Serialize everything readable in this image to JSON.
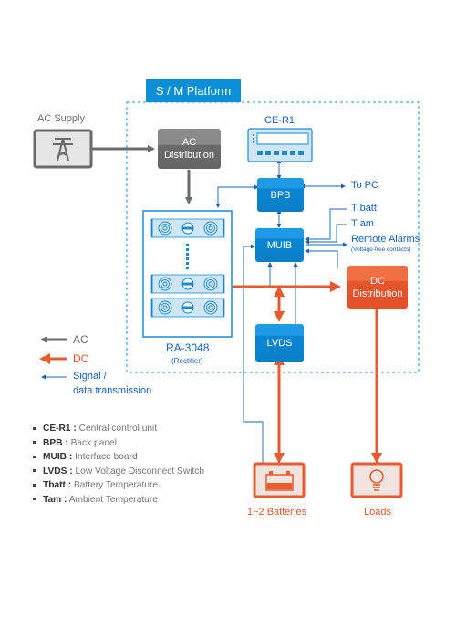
{
  "platform": {
    "title": "S / M Platform"
  },
  "nodes": {
    "ac_supply": {
      "label": "AC Supply",
      "icon": "power-tower-icon"
    },
    "ac_distribution": {
      "line1": "AC",
      "line2": "Distribution"
    },
    "ce_r1": {
      "label": "CE-R1",
      "icon": "control-unit-icon"
    },
    "bpb": {
      "label": "BPB"
    },
    "muib": {
      "label": "MUIB"
    },
    "lvds": {
      "label": "LVDS"
    },
    "rectifier": {
      "label": "RA-3048",
      "sublabel": "(Rectifier)",
      "icon": "rectifier-module-icon"
    },
    "dc_distribution": {
      "line1": "DC",
      "line2": "Distribution"
    },
    "batteries": {
      "label": "1~2 Batteries",
      "icon": "battery-icon"
    },
    "loads": {
      "label": "Loads",
      "icon": "lightbulb-icon"
    }
  },
  "signals": {
    "to_pc": "To PC",
    "t_batt": "T  batt",
    "t_am": "T  am",
    "remote_alarms": "Remote Alarms",
    "remote_alarms_note": "(Voltage-free contacts)"
  },
  "legend": {
    "ac": "AC",
    "dc": "DC",
    "signal_line1": "Signal /",
    "signal_line2": "data  transmission"
  },
  "abbreviations": [
    {
      "term": "CE-R1 :",
      "desc": "Central control unit"
    },
    {
      "term": "BPB :",
      "desc": "Back panel"
    },
    {
      "term": "MUIB :",
      "desc": "Interface board"
    },
    {
      "term": "LVDS :",
      "desc": "Low Voltage Disconnect Switch"
    },
    {
      "term": "Tbatt :",
      "desc": "Battery Temperature"
    },
    {
      "term": "Tam :",
      "desc": "Ambient Temperature"
    }
  ],
  "colors": {
    "ac": "#6b6b6b",
    "dc": "#e85a2f",
    "signal": "#1a63b5",
    "platform": "#0a8fd6"
  }
}
